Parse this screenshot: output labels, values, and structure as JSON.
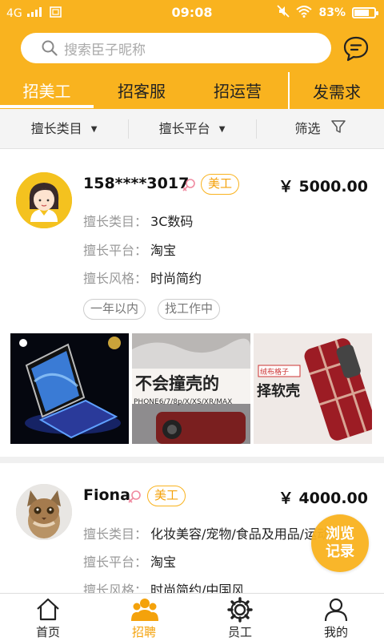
{
  "status_bar": {
    "network": "4G",
    "time": "09:08",
    "battery": "83%"
  },
  "search": {
    "placeholder": "搜索臣子昵称"
  },
  "tabs": [
    {
      "label": "招美工"
    },
    {
      "label": "招客服"
    },
    {
      "label": "招运营"
    }
  ],
  "post_button": "发需求",
  "filters": [
    {
      "label": "擅长类目"
    },
    {
      "label": "擅长平台"
    },
    {
      "label": "筛选"
    }
  ],
  "candidates": [
    {
      "name": "158****3017",
      "badge": "美工",
      "price": "￥ 5000.00",
      "category_label": "擅长类目：",
      "category": "3C数码",
      "platform_label": "擅长平台：",
      "platform": "淘宝",
      "style_label": "擅长风格：",
      "style": "时尚简约",
      "tags": [
        "一年以内",
        "找工作中"
      ],
      "portfolio": [
        {
          "caption": ""
        },
        {
          "caption": "不会撞壳的 PHONE6/7/8p/X/XS/XR/MAX"
        },
        {
          "caption": "绒布格子 择软壳"
        }
      ]
    },
    {
      "name": "Fiona",
      "badge": "美工",
      "price": "￥ 4000.00",
      "category_label": "擅长类目：",
      "category": "化妆美容/宠物/食品及用品/运动",
      "platform_label": "擅长平台：",
      "platform": "淘宝",
      "style_label": "擅长风格：",
      "style": "时尚简约/中国风"
    }
  ],
  "history_button": {
    "line1": "浏览",
    "line2": "记录"
  },
  "bottom_nav": [
    {
      "label": "首页",
      "icon": "home-icon"
    },
    {
      "label": "招聘",
      "icon": "recruit-icon",
      "active": true
    },
    {
      "label": "员工",
      "icon": "gear-icon"
    },
    {
      "label": "我的",
      "icon": "profile-icon"
    }
  ],
  "colors": {
    "accent": "#f9b31f",
    "accent_text": "#f4a20b"
  }
}
